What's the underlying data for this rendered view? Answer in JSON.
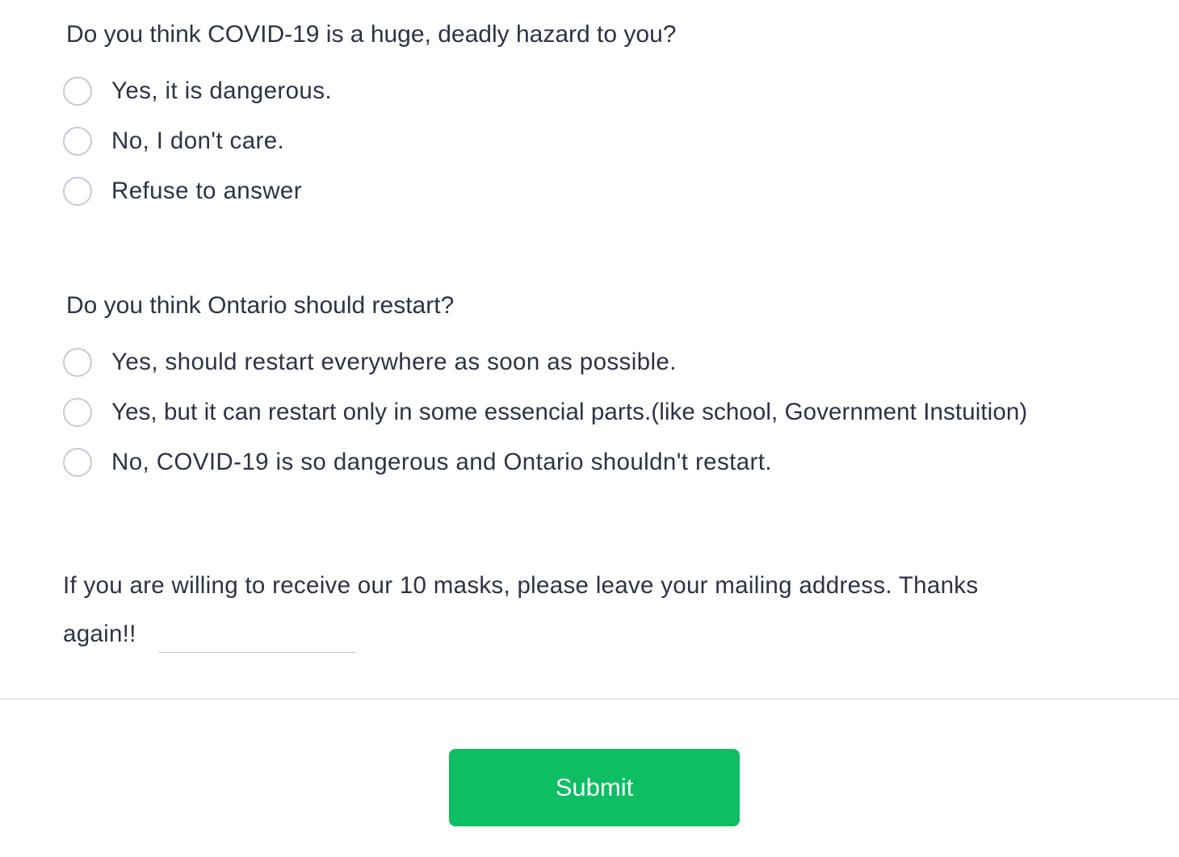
{
  "questions": [
    {
      "title": "Do you think COVID-19 is a huge, deadly hazard to you?",
      "options": [
        "Yes, it is dangerous.",
        "No, I don't care.",
        "Refuse to answer"
      ]
    },
    {
      "title": "Do you think Ontario should restart?",
      "options": [
        "Yes, should restart everywhere as soon as possible.",
        "Yes, but it can restart only in some essencial parts.(like school, Government Instuition)",
        "No, COVID-19 is so dangerous and Ontario shouldn't restart."
      ]
    }
  ],
  "mask_prompt": {
    "line1": "If you are willing to receive our 10 masks, please leave your mailing address. Thanks",
    "line2": "again!!",
    "address_value": ""
  },
  "submit_label": "Submit",
  "colors": {
    "text": "#2c3345",
    "submit": "#0ebe62",
    "radio_border": "#c3cad8"
  }
}
